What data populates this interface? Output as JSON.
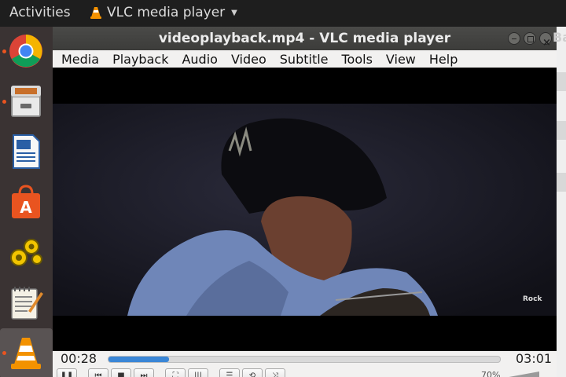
{
  "topbar": {
    "activities": "Activities",
    "app_name": "VLC media player"
  },
  "dock": {
    "items": [
      {
        "name": "Google Chrome",
        "icon": "chrome-icon",
        "running": true
      },
      {
        "name": "Files",
        "icon": "file-cabinet-icon",
        "running": true
      },
      {
        "name": "LibreOffice Writer",
        "icon": "writer-document-icon",
        "running": false
      },
      {
        "name": "Ubuntu Software",
        "icon": "shopping-bag-icon",
        "running": false
      },
      {
        "name": "Settings",
        "icon": "gears-icon",
        "running": false
      },
      {
        "name": "Text Editor",
        "icon": "notepad-icon",
        "running": false
      },
      {
        "name": "VLC media player",
        "icon": "vlc-cone-icon",
        "running": true
      }
    ]
  },
  "window": {
    "title": "videoplayback.mp4 - VLC media player",
    "partial_text": "Ba"
  },
  "menu": [
    "Media",
    "Playback",
    "Audio",
    "Video",
    "Subtitle",
    "Tools",
    "View",
    "Help"
  ],
  "video": {
    "watermark": "Rock"
  },
  "controls": {
    "current_time": "00:28",
    "total_time": "03:01",
    "progress": 0.155,
    "volume": "70%"
  },
  "colors": {
    "accent": "#3a86d6",
    "dock_dot": "#e95420",
    "vlc_orange": "#f39200"
  }
}
